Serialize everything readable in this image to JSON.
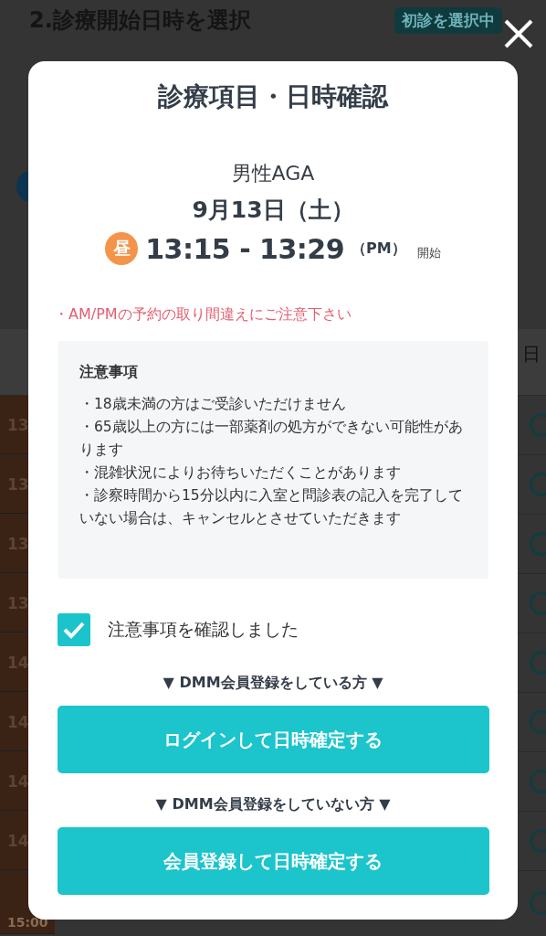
{
  "background": {
    "title": "2.診療開始日時を選択",
    "badge": "初診を選択中",
    "right_header": "日",
    "time_labels": [
      "13",
      "13",
      "13",
      "13",
      "14",
      "14",
      "14",
      "14",
      "15:00"
    ]
  },
  "modal": {
    "title": "診療項目・日時確認",
    "treatment": "男性AGA",
    "date": "9月13日（土）",
    "time": {
      "period_icon": "昼",
      "range": "13:15 - 13:29",
      "meridiem": "（PM）",
      "suffix": "開始"
    },
    "warning": "・AM/PMの予約の取り間違えにご注意下さい",
    "notice": {
      "heading": "注意事項",
      "items": [
        "・18歳未満の方はご受診いただけません",
        "・65歳以上の方には一部薬剤の処方ができない可能性があります",
        "・混雑状況によりお待ちいただくことがあります",
        "・診察時間から15分以内に入室と問診表の記入を完了していない場合は、キャンセルとさせていただきます"
      ]
    },
    "confirm": {
      "label": "注意事項を確認しました",
      "checked": true
    },
    "groups": [
      {
        "caption": "▼ DMM会員登録をしている方 ▼",
        "button": "ログインして日時確定する"
      },
      {
        "caption": "▼ DMM会員登録をしていない方 ▼",
        "button": "会員登録して日時確定する"
      }
    ]
  }
}
